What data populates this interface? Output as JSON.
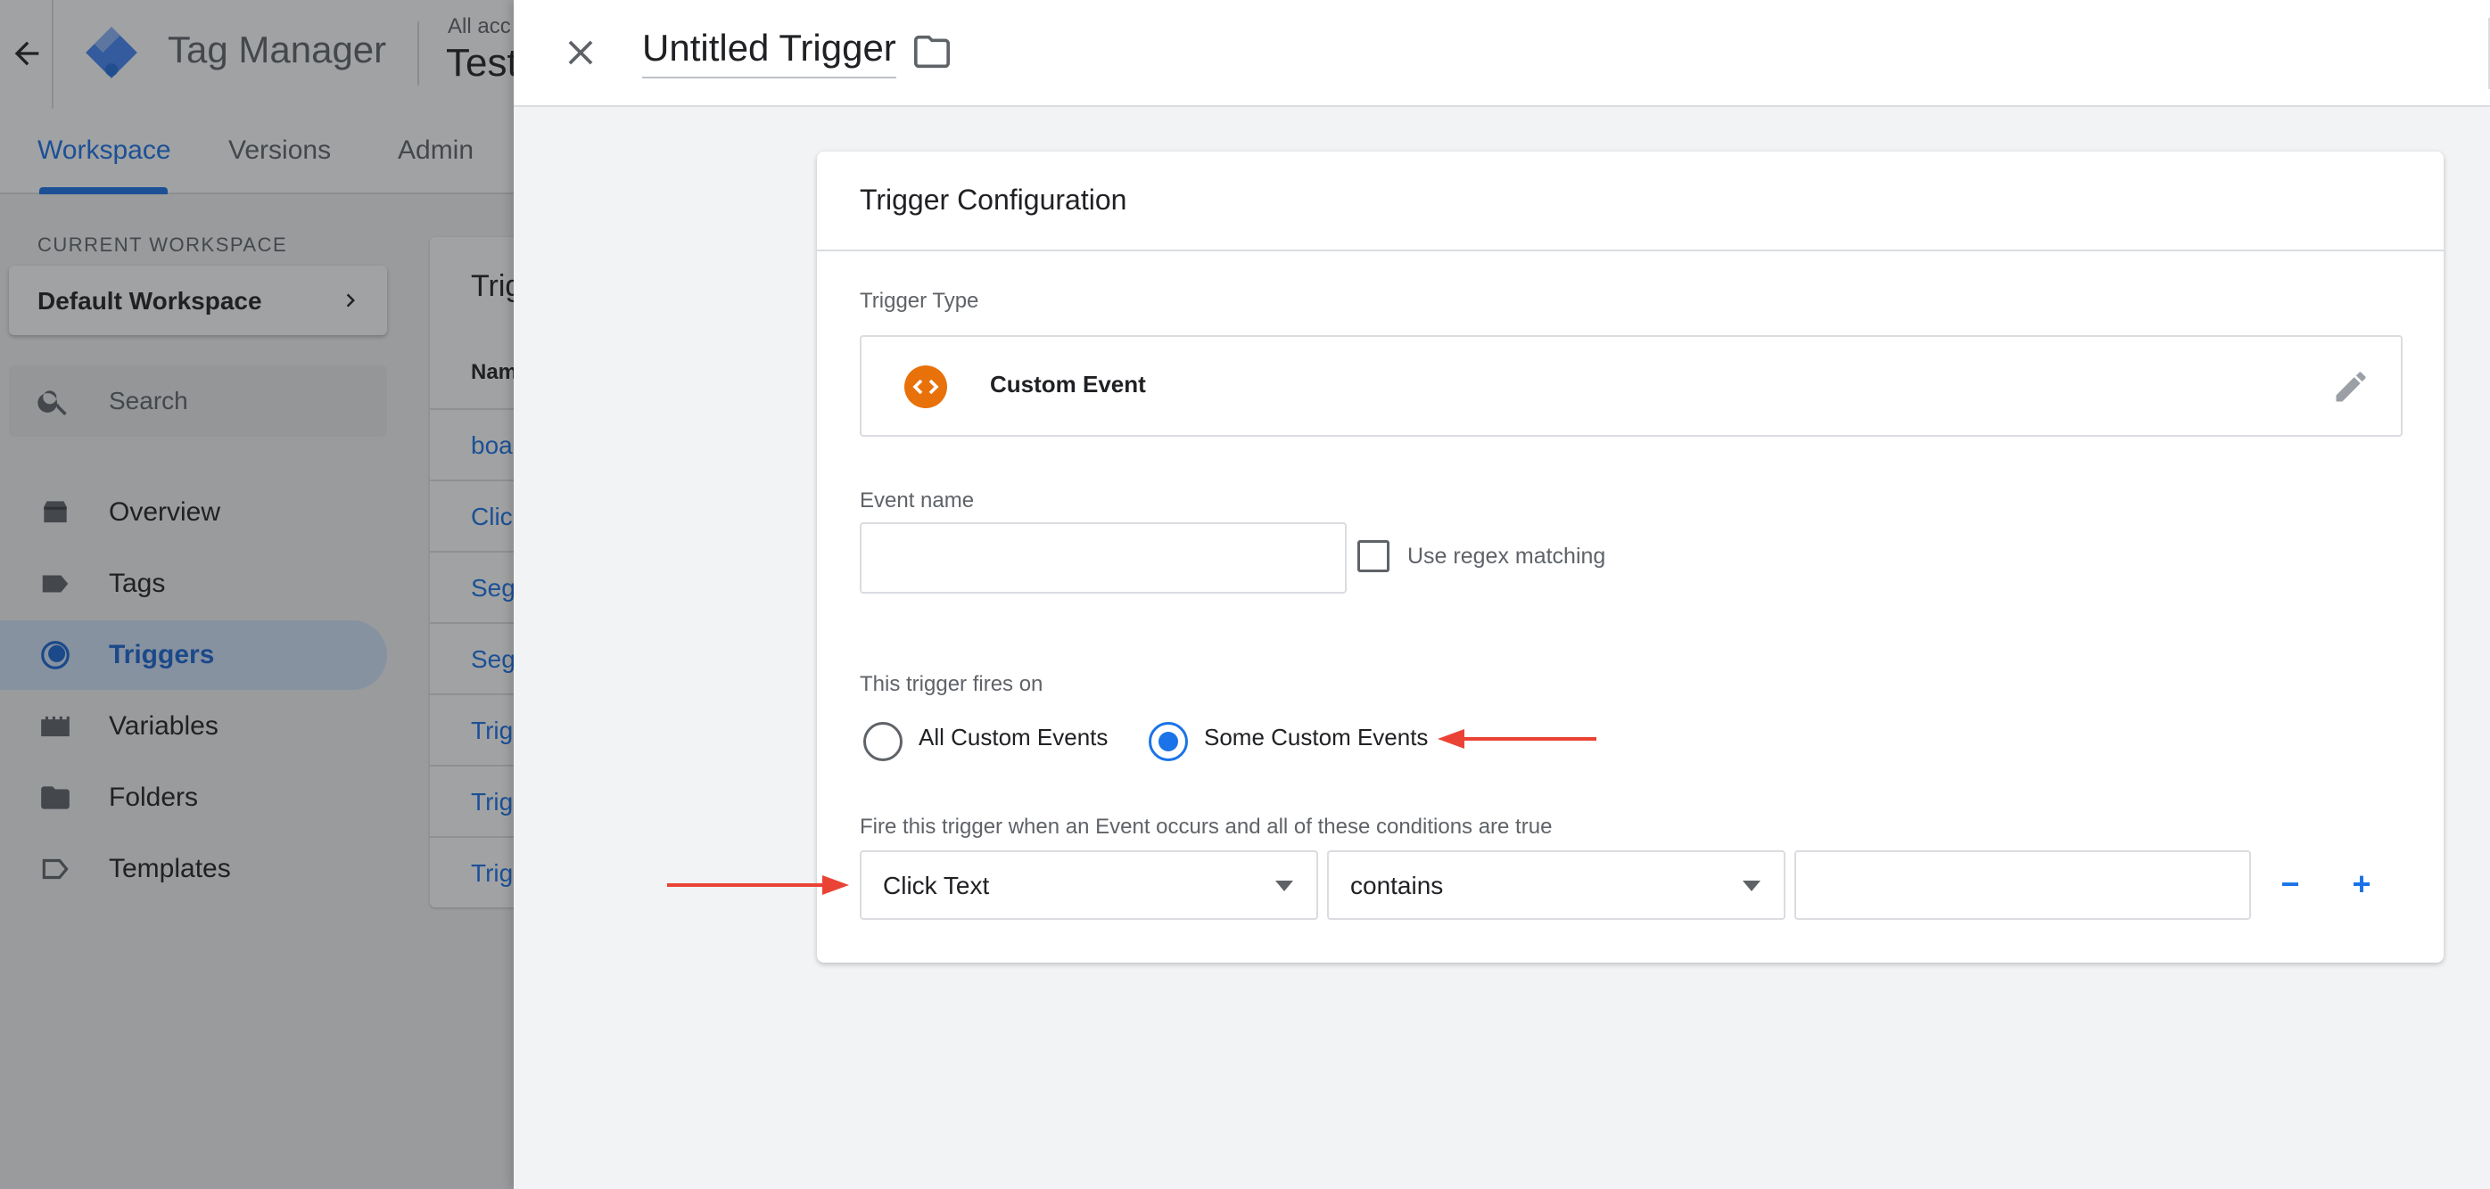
{
  "app": {
    "product_name": "Tag Manager",
    "breadcrumb": "All acc",
    "container_name": "Test",
    "back_icon": "arrow-left-icon"
  },
  "subnav": {
    "tabs": [
      {
        "label": "Workspace",
        "active": true
      },
      {
        "label": "Versions",
        "active": false
      },
      {
        "label": "Admin",
        "active": false
      }
    ]
  },
  "sidebar": {
    "current_workspace_label": "CURRENT WORKSPACE",
    "workspace_name": "Default Workspace",
    "search_placeholder": "Search",
    "items": [
      {
        "label": "Overview",
        "icon": "overview-icon",
        "active": false
      },
      {
        "label": "Tags",
        "icon": "tag-icon",
        "active": false
      },
      {
        "label": "Triggers",
        "icon": "trigger-icon",
        "active": true
      },
      {
        "label": "Variables",
        "icon": "variables-icon",
        "active": false
      },
      {
        "label": "Folders",
        "icon": "folder-icon",
        "active": false
      },
      {
        "label": "Templates",
        "icon": "template-icon",
        "active": false
      }
    ]
  },
  "triggers_list": {
    "title": "Trig",
    "column_header": "Nam",
    "rows": [
      "boa",
      "Clic",
      "Seg",
      "Seg",
      "Trig",
      "Trig",
      "Trig"
    ]
  },
  "panel": {
    "title": "Untitled Trigger",
    "close_icon": "close-icon",
    "folder_icon": "folder-icon"
  },
  "config": {
    "heading": "Trigger Configuration",
    "trigger_type_label": "Trigger Type",
    "trigger_type_name": "Custom Event",
    "event_name_label": "Event name",
    "event_name_value": "",
    "regex_label": "Use regex matching",
    "regex_checked": false,
    "fires_on_label": "This trigger fires on",
    "fires_on_options": [
      {
        "label": "All Custom Events",
        "checked": false
      },
      {
        "label": "Some Custom Events",
        "checked": true
      }
    ],
    "condition_label": "Fire this trigger when an Event occurs and all of these conditions are true",
    "condition": {
      "variable": "Click Text",
      "operator": "contains",
      "value": ""
    },
    "remove_label": "−",
    "add_label": "+"
  },
  "colors": {
    "accent": "#1a73e8",
    "custom_event_badge": "#e8710a",
    "annotation_arrow": "#ea4335"
  }
}
